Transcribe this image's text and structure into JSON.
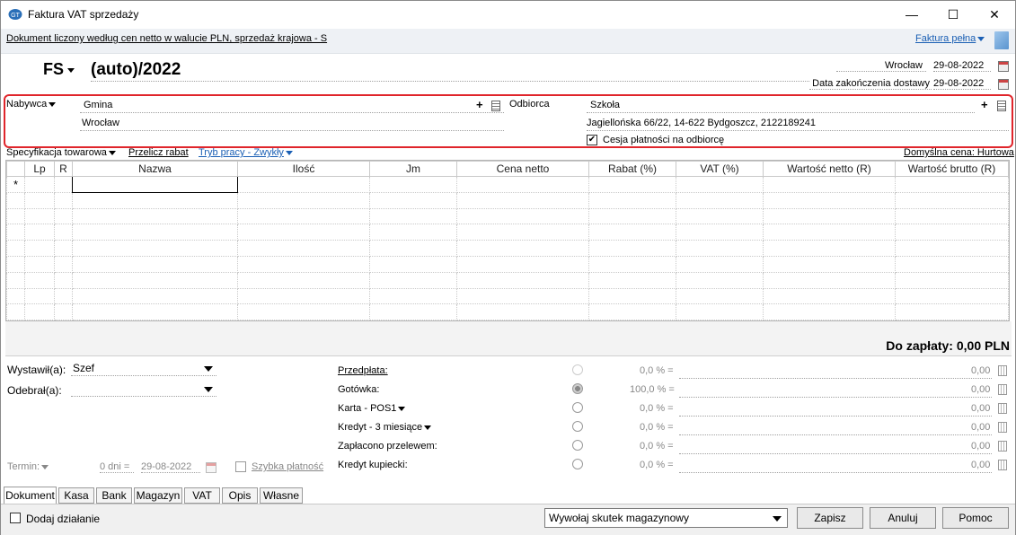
{
  "window": {
    "title": "Faktura VAT sprzedaży",
    "minimize": "—",
    "maximize": "☐",
    "close": "✕"
  },
  "infobar": {
    "doc_mode": "Dokument liczony według cen netto w walucie PLN, sprzedaż krajowa - S",
    "view_mode": "Faktura pełna"
  },
  "header": {
    "doc_type": "FS",
    "doc_number": "(auto)/2022",
    "city": "Wrocław",
    "issue_date": "29-08-2022",
    "delivery_label": "Data zakończenia dostawy",
    "delivery_date": "29-08-2022"
  },
  "buyer": {
    "label": "Nabywca",
    "name": "Gmina",
    "address": "Wrocław"
  },
  "recipient": {
    "label": "Odbiorca",
    "name": "Szkoła",
    "address": "Jagiellońska  66/22, 14-622 Bydgoszcz, 2122189241",
    "cession_label": "Cesja płatności na odbiorcę",
    "cession_checked": "✔"
  },
  "toolbar": {
    "spec": "Specyfikacja towarowa",
    "recalc": "Przelicz rabat",
    "work_mode": "Tryb pracy - Zwykły",
    "default_price": "Domyślna cena: Hurtowa"
  },
  "grid": {
    "new_row_marker": "*",
    "columns": [
      {
        "label": ""
      },
      {
        "label": "Lp"
      },
      {
        "label": "R"
      },
      {
        "label": "Nazwa"
      },
      {
        "label": "Ilość"
      },
      {
        "label": "Jm"
      },
      {
        "label": "Cena netto"
      },
      {
        "label": "Rabat (%)"
      },
      {
        "label": "VAT (%)"
      },
      {
        "label": "Wartość netto (R)"
      },
      {
        "label": "Wartość brutto (R)"
      }
    ]
  },
  "summary": {
    "to_pay": "Do zapłaty: 0,00 PLN"
  },
  "left_fields": {
    "issued_label": "Wystawił(a):",
    "issued_value": "Szef",
    "received_label": "Odebrał(a):",
    "received_value": "",
    "term_label": "Termin:",
    "term_days": "0 dni =",
    "term_date": "29-08-2022",
    "quick_pay": "Szybka płatność"
  },
  "payments": [
    {
      "label": "Przedpłata:",
      "percent": "0,0 % =",
      "amount": "0,00"
    },
    {
      "label": "Gotówka:",
      "percent": "100,0 % =",
      "amount": "0,00"
    },
    {
      "label": "Karta - POS1",
      "percent": "0,0 % =",
      "amount": "0,00"
    },
    {
      "label": "Kredyt - 3 miesiące",
      "percent": "0,0 % =",
      "amount": "0,00"
    },
    {
      "label": "Zapłacono przelewem:",
      "percent": "0,0 % =",
      "amount": "0,00"
    },
    {
      "label": "Kredyt kupiecki:",
      "percent": "0,0 % =",
      "amount": "0,00"
    }
  ],
  "tabs": [
    "Dokument",
    "Kasa",
    "Bank",
    "Magazyn",
    "VAT",
    "Opis",
    "Własne"
  ],
  "footer": {
    "add_action": "Dodaj działanie",
    "stock_effect": "Wywołaj skutek magazynowy",
    "save": "Zapisz",
    "cancel": "Anuluj",
    "help": "Pomoc"
  },
  "colors": {
    "accent": "#1a5fb4",
    "highlight_box": "#e0252b"
  }
}
